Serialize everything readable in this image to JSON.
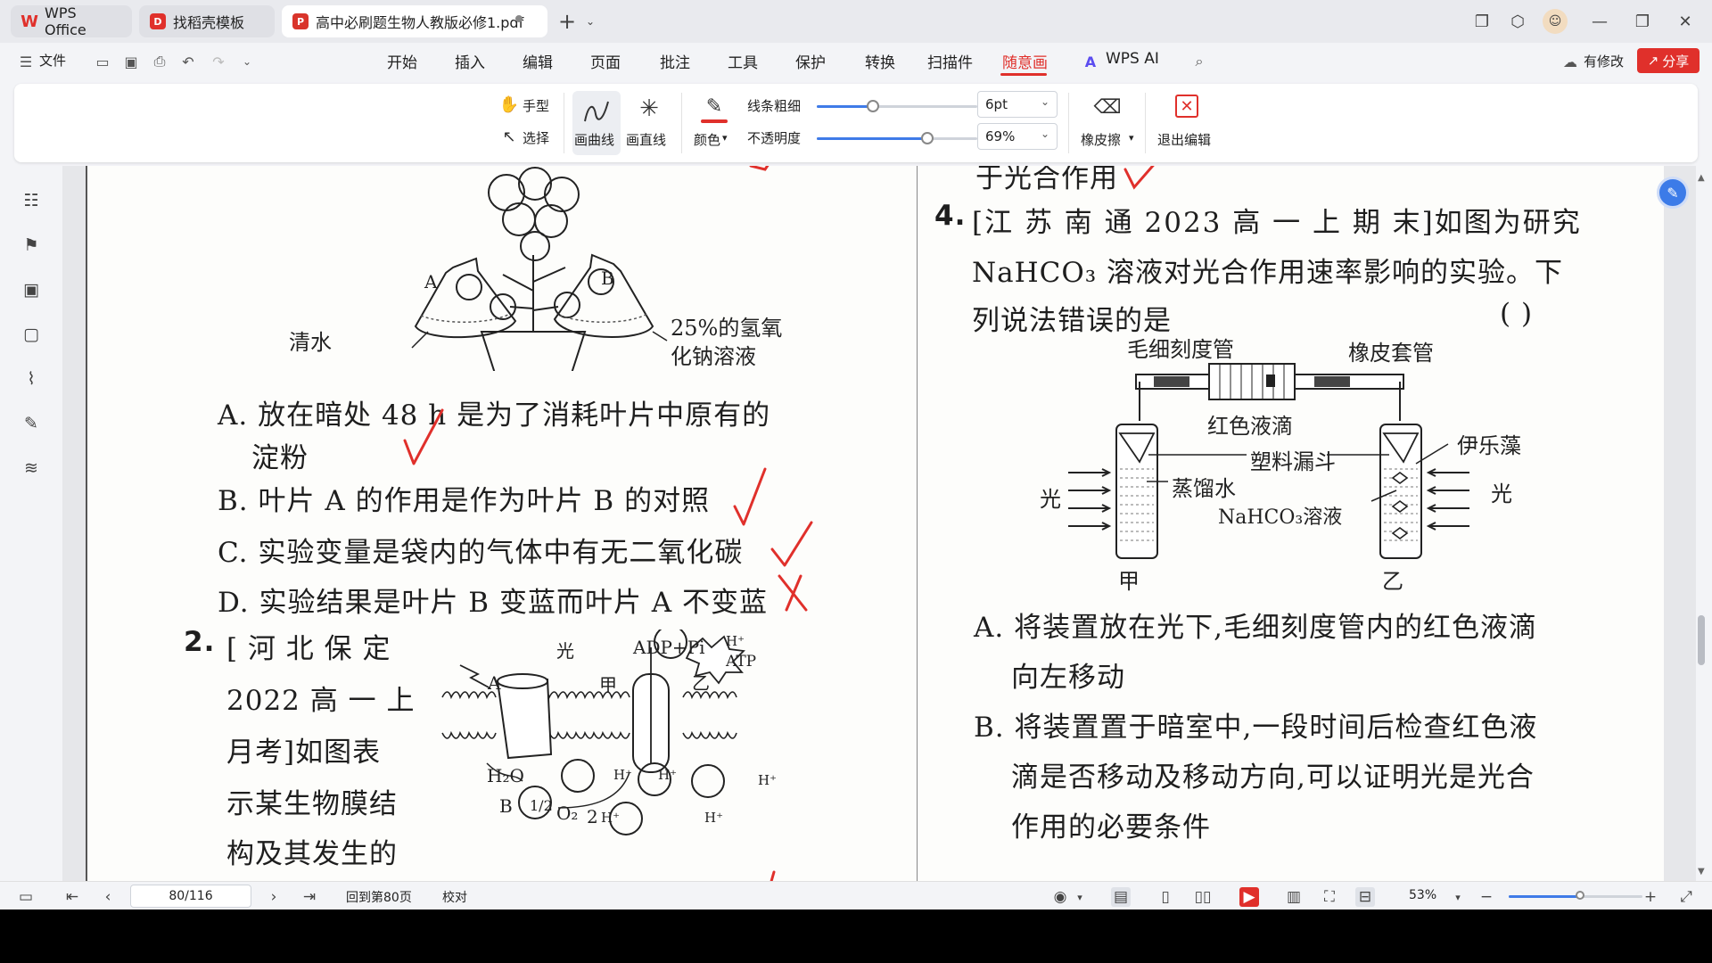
{
  "titlebar": {
    "tabs": [
      {
        "label": "WPS Office"
      },
      {
        "label": "找稻壳模板"
      },
      {
        "label": "高中必刷题生物人教版必修1.pdf"
      }
    ]
  },
  "menubar": {
    "file_label": "文件",
    "items": [
      "开始",
      "插入",
      "编辑",
      "页面",
      "批注",
      "工具",
      "保护",
      "转换",
      "扫描件",
      "随意画",
      "WPS AI"
    ],
    "active_item": "随意画",
    "modify_label": "有修改",
    "share_label": "分享"
  },
  "ribbon": {
    "hand_label": "手型",
    "select_label": "选择",
    "draw_curve_label": "画曲线",
    "draw_line_label": "画直线",
    "color_label": "颜色",
    "line_width_label": "线条粗细",
    "opacity_label": "不透明度",
    "line_width_value": "6pt",
    "opacity_value": "69%",
    "line_width_level": 0.35,
    "opacity_level": 0.69,
    "eraser_label": "橡皮擦",
    "exit_label": "退出编辑",
    "pen_color": "#e0302b"
  },
  "document": {
    "left": {
      "top_fragment": "",
      "flask_left_label": "清水",
      "flask_right_label_1": "25%的氢氧",
      "flask_right_label_2": "化钠溶液",
      "flask_a": "A",
      "flask_b": "B",
      "optA_1": "A. 放在暗处 48 h 是为了消耗叶片中原有的",
      "optA_2": "淀粉",
      "optB": "B. 叶片 A 的作用是作为叶片 B 的对照",
      "optC": "C. 实验变量是袋内的气体中有无二氧化碳",
      "optD": "D. 实验结果是叶片 B 变蓝而叶片 A 不变蓝",
      "q2_num": "2.",
      "q2_line1": "[ 河  北  保  定",
      "q2_line2": "2022  高  一  上",
      "q2_line3": "月考]如图表",
      "q2_line4": "示某生物膜结",
      "q2_line5": "构及其发生的",
      "mem_labels": {
        "guang": "光",
        "adp": "ADP+Pi",
        "atp": "ATP",
        "a": "A",
        "jia": "甲",
        "yi": "乙",
        "h2o": "H₂O",
        "b": "B",
        "half": "1/2",
        "o2": "O₂",
        "two": "2",
        "hplus": "H⁺"
      }
    },
    "right": {
      "top_fragment": "于光合作用",
      "q4_num": "4.",
      "q4_line1": "[江 苏 南 通  2023  高 一 上 期 末]如图为研究",
      "q4_line2": "NaHCO₃ 溶液对光合作用速率影响的实验。下",
      "q4_line3": "列说法错误的是",
      "q4_paren": "(      )",
      "diag": {
        "capillary": "毛细刻度管",
        "rubber": "橡皮套管",
        "red_drop": "红色液滴",
        "funnel": "塑料漏斗",
        "elodea": "伊乐藻",
        "water": "蒸馏水",
        "nahco3": "NaHCO₃溶液",
        "light_left": "光",
        "light_right": "光",
        "jia": "甲",
        "yi": "乙"
      },
      "optA_1": "A. 将装置放在光下,毛细刻度管内的红色液滴",
      "optA_2": "向左移动",
      "optB_1": "B. 将装置置于暗室中,一段时间后检查红色液",
      "optB_2": "滴是否移动及移动方向,可以证明光是光合",
      "optB_3": "作用的必要条件"
    }
  },
  "statusbar": {
    "page_value": "80/116",
    "goto_label": "回到第80页",
    "proof_label": "校对",
    "zoom_label": "53%",
    "zoom_level": 0.53
  }
}
